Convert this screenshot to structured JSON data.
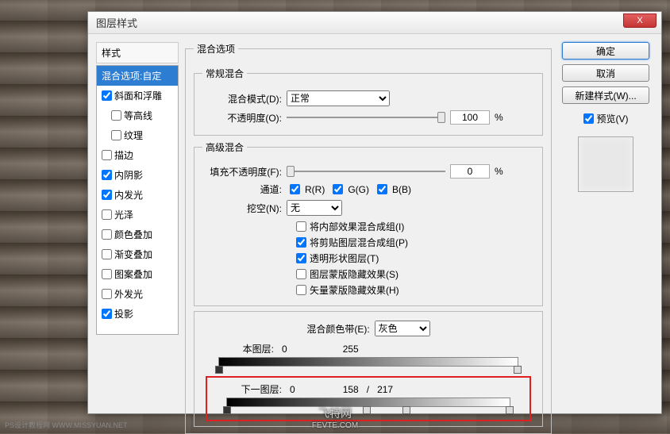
{
  "dialog": {
    "title": "图层样式",
    "close_label": "X"
  },
  "styles": {
    "header": "样式",
    "items": [
      {
        "label": "混合选项:自定",
        "selected": true,
        "checkbox": false
      },
      {
        "label": "斜面和浮雕",
        "checked": true,
        "checkbox": true
      },
      {
        "label": "等高线",
        "checked": false,
        "checkbox": true,
        "indented": true
      },
      {
        "label": "纹理",
        "checked": false,
        "checkbox": true,
        "indented": true
      },
      {
        "label": "描边",
        "checked": false,
        "checkbox": true
      },
      {
        "label": "内阴影",
        "checked": true,
        "checkbox": true
      },
      {
        "label": "内发光",
        "checked": true,
        "checkbox": true
      },
      {
        "label": "光泽",
        "checked": false,
        "checkbox": true
      },
      {
        "label": "颜色叠加",
        "checked": false,
        "checkbox": true
      },
      {
        "label": "渐变叠加",
        "checked": false,
        "checkbox": true
      },
      {
        "label": "图案叠加",
        "checked": false,
        "checkbox": true
      },
      {
        "label": "外发光",
        "checked": false,
        "checkbox": true
      },
      {
        "label": "投影",
        "checked": true,
        "checkbox": true
      }
    ]
  },
  "blend_options": {
    "title": "混合选项",
    "general": {
      "title": "常规混合",
      "blend_mode_label": "混合模式(D):",
      "blend_mode_value": "正常",
      "opacity_label": "不透明度(O):",
      "opacity_value": "100",
      "percent": "%"
    },
    "advanced": {
      "title": "高级混合",
      "fill_opacity_label": "填充不透明度(F):",
      "fill_opacity_value": "0",
      "percent": "%",
      "channels_label": "通道:",
      "channel_r": "R(R)",
      "channel_g": "G(G)",
      "channel_b": "B(B)",
      "knockout_label": "挖空(N):",
      "knockout_value": "无",
      "options": [
        {
          "label": "将内部效果混合成组(I)",
          "checked": false
        },
        {
          "label": "将剪贴图层混合成组(P)",
          "checked": true
        },
        {
          "label": "透明形状图层(T)",
          "checked": true
        },
        {
          "label": "图层蒙版隐藏效果(S)",
          "checked": false
        },
        {
          "label": "矢量蒙版隐藏效果(H)",
          "checked": false
        }
      ]
    },
    "blend_if": {
      "label": "混合颜色带(E):",
      "value": "灰色",
      "this_layer": {
        "label": "本图层:",
        "low": "0",
        "high": "255"
      },
      "underlying": {
        "label": "下一图层:",
        "low": "0",
        "mid1": "158",
        "sep": "/",
        "mid2": "217"
      }
    }
  },
  "buttons": {
    "ok": "确定",
    "cancel": "取消",
    "new_style": "新建样式(W)...",
    "preview": "预览(V)"
  },
  "watermark": {
    "left": "PS设计教程网 WWW.MISSYUAN.NET",
    "center_top": "飞特网",
    "center_bottom": "FEVTE.COM"
  }
}
